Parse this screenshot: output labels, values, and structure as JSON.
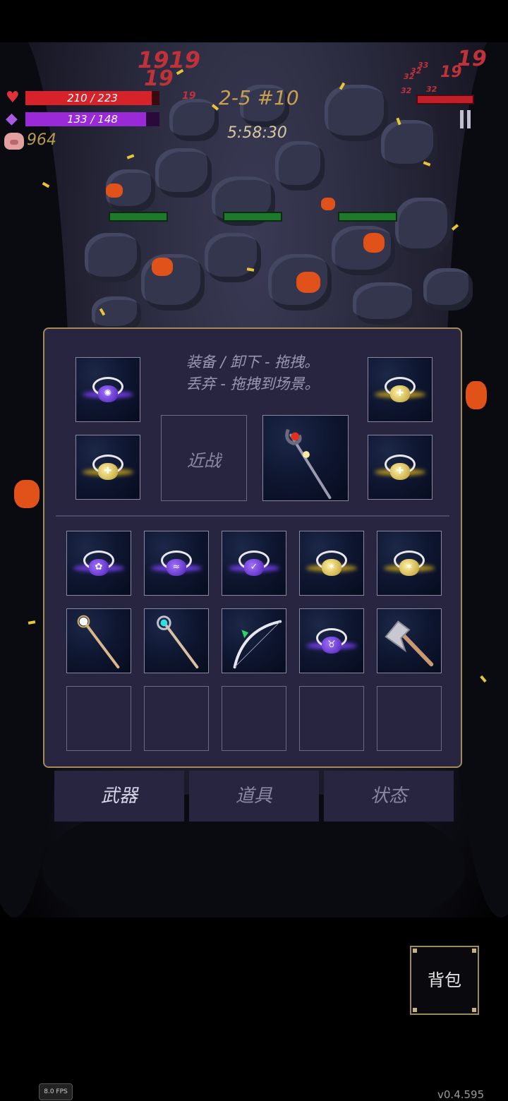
{
  "hud": {
    "hp_text": "210 / 223",
    "hp_fraction": 0.94,
    "mp_text": "133 / 148",
    "mp_fraction": 0.9,
    "coins": "964",
    "stage": "2-5 #10",
    "timer": "5:58:30",
    "colors": {
      "hp": "#d8222a",
      "mp": "#9a2ad8",
      "coin": "#b79a52",
      "stage": "#c9a050"
    }
  },
  "floating_numbers": [
    "1919",
    "19",
    "19",
    "32",
    "32",
    "33",
    "32",
    "32",
    "19",
    "19"
  ],
  "inventory": {
    "hint_line1": "装备 / 卸下 - 拖拽。",
    "hint_line2": "丢弃 - 拖拽到场景。",
    "melee_label": "近战",
    "equipped_left": [
      {
        "icon": "purple-ring-icon"
      },
      {
        "icon": "yellow-ring-icon"
      }
    ],
    "equipped_right": [
      {
        "icon": "yellow-ring-icon"
      },
      {
        "icon": "yellow-ring-icon"
      }
    ],
    "equipped_weapon": {
      "icon": "red-orb-staff-icon"
    },
    "grid_row1": [
      "purple-ring-icon",
      "purple-ring-icon",
      "purple-ring-icon",
      "yellow-ring-icon",
      "yellow-ring-icon"
    ],
    "grid_row2": [
      "white-orb-staff-icon",
      "cyan-orb-staff-icon",
      "bow-icon",
      "purple-ring-icon",
      "axe-icon"
    ],
    "grid_row3_empty": 5
  },
  "tabs": [
    {
      "label": "武器",
      "active": true
    },
    {
      "label": "道具",
      "active": false
    },
    {
      "label": "状态",
      "active": false
    }
  ],
  "bag_button": "背包",
  "fps": "8.0 FPS",
  "version": "v0.4.595"
}
